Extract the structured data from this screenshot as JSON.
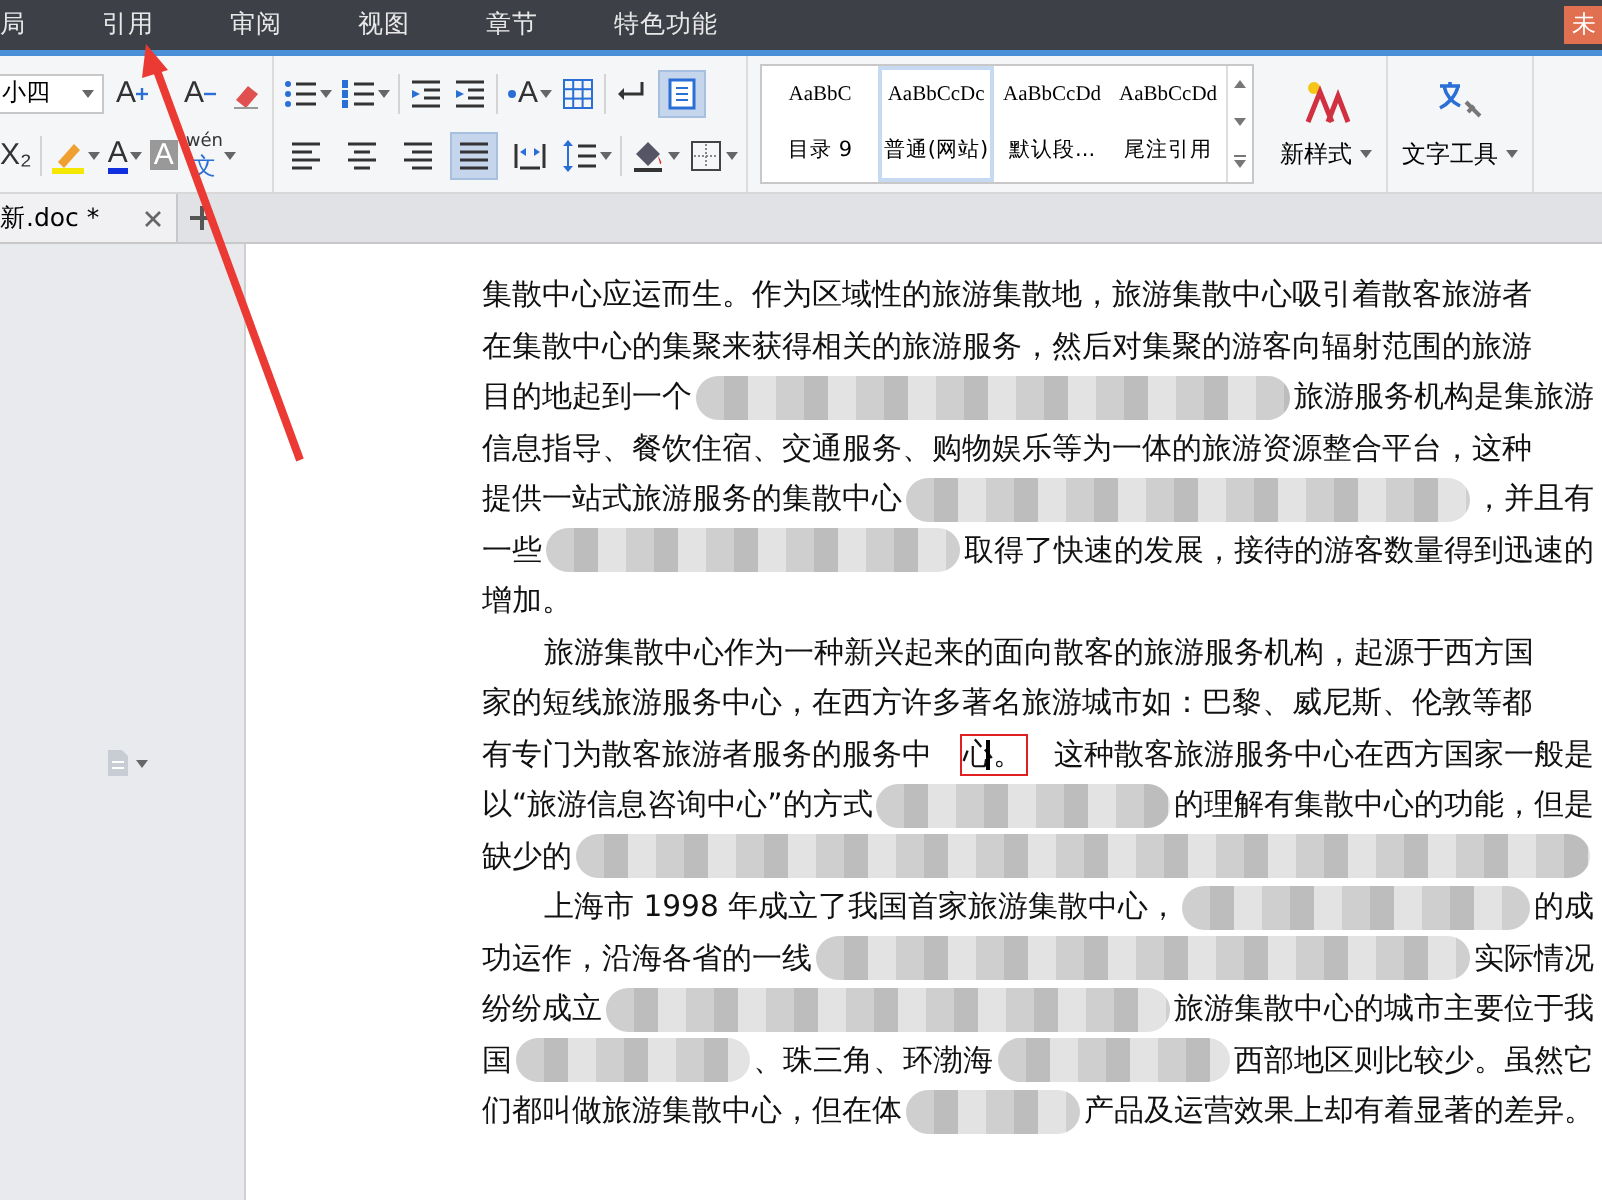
{
  "menu_tabs": [
    {
      "label": "局"
    },
    {
      "label": "引用"
    },
    {
      "label": "审阅"
    },
    {
      "label": "视图"
    },
    {
      "label": "章节"
    },
    {
      "label": "特色功能"
    }
  ],
  "login_button": "未",
  "ribbon": {
    "font_size": "小四",
    "row1": [
      {
        "kind": "grow-font",
        "glyph": "A"
      },
      {
        "kind": "shrink-font",
        "glyph": "A"
      },
      {
        "kind": "clear-format"
      },
      {
        "kind": "bullets"
      },
      {
        "kind": "numbering"
      },
      {
        "kind": "sep"
      },
      {
        "kind": "outdent"
      },
      {
        "kind": "indent"
      },
      {
        "kind": "sep"
      },
      {
        "kind": "text-direction",
        "glyph": "A"
      },
      {
        "kind": "table-grid"
      },
      {
        "kind": "sep"
      },
      {
        "kind": "return-mark"
      },
      {
        "kind": "border-box",
        "on": true
      }
    ],
    "row2": [
      {
        "kind": "subscript",
        "glyph": "X₂"
      },
      {
        "kind": "sep"
      },
      {
        "kind": "highlight"
      },
      {
        "kind": "font-color",
        "glyph": "A"
      },
      {
        "kind": "char-shading",
        "glyph": "A"
      },
      {
        "kind": "pinyin",
        "glyph": "wén",
        "sub": "文"
      }
    ],
    "align": [
      {
        "kind": "left",
        "selected": false
      },
      {
        "kind": "center",
        "selected": false
      },
      {
        "kind": "right",
        "selected": false
      },
      {
        "kind": "justify",
        "selected": true
      },
      {
        "kind": "distributed",
        "selected": false
      }
    ],
    "row2b": [
      {
        "kind": "line-spacing"
      },
      {
        "kind": "sep"
      },
      {
        "kind": "shading"
      },
      {
        "kind": "borders"
      }
    ],
    "styles": [
      {
        "sample": "AaBbC",
        "label": "目录 9",
        "selected": false
      },
      {
        "sample": "AaBbCcDc",
        "label": "普通(网站)",
        "selected": true
      },
      {
        "sample": "AaBbCcDd",
        "label": "默认段...",
        "selected": false
      },
      {
        "sample": "AaBbCcDd",
        "label": "尾注引用",
        "selected": false
      }
    ],
    "new_style": "新样式",
    "text_tools": "文字工具"
  },
  "doc_tab": {
    "title": "新.doc *"
  },
  "document": {
    "lines": [
      {
        "indent": false,
        "segments": [
          {
            "kind": "text",
            "text": "集散中心应运而生。作为区域性的旅游集散地，旅游集散中心吸引着散客旅游者"
          }
        ]
      },
      {
        "indent": false,
        "segments": [
          {
            "kind": "text",
            "text": "在集散中心的集聚来获得相关的旅游服务，然后对集聚的游客向辐射范围的旅游"
          }
        ]
      },
      {
        "indent": false,
        "segments": [
          {
            "kind": "text",
            "text": "目的地起到一个"
          },
          {
            "kind": "redacted"
          },
          {
            "kind": "text",
            "text": "旅游服务机构是集旅游"
          }
        ]
      },
      {
        "indent": false,
        "segments": [
          {
            "kind": "text",
            "text": "信息指导、餐饮住宿、交通服务、购物娱乐等为一体的旅游资源整合平台，这种"
          }
        ]
      },
      {
        "indent": false,
        "segments": [
          {
            "kind": "text",
            "text": "提供一站式旅游服务的集散中心"
          },
          {
            "kind": "redacted"
          },
          {
            "kind": "text",
            "text": "，并且有"
          }
        ]
      },
      {
        "indent": false,
        "segments": [
          {
            "kind": "text",
            "text": "一些"
          },
          {
            "kind": "redacted"
          },
          {
            "kind": "text",
            "text": "取得了快速的发展，接待的游客数量得到迅速的"
          }
        ]
      },
      {
        "indent": false,
        "segments": [
          {
            "kind": "text",
            "text": "增加。"
          }
        ]
      },
      {
        "indent": true,
        "segments": [
          {
            "kind": "text",
            "text": "旅游集散中心作为一种新兴起来的面向散客的旅游服务机构，起源于西方国"
          }
        ]
      },
      {
        "indent": false,
        "segments": [
          {
            "kind": "text",
            "text": "家的短线旅游服务中心，在西方许多著名旅游城市如：巴黎、威尼斯、伦敦等都"
          }
        ]
      },
      {
        "indent": false,
        "segments": [
          {
            "kind": "text",
            "text": "有专门为散客旅游者服务的服务中"
          },
          {
            "kind": "boxed",
            "text": "心。",
            "cursor": true
          },
          {
            "kind": "text",
            "text": "这种散客旅游服务中心在西方国家一般是"
          }
        ]
      },
      {
        "indent": false,
        "segments": [
          {
            "kind": "text",
            "text": "以“旅游信息咨询中心”的方式"
          },
          {
            "kind": "redacted"
          },
          {
            "kind": "text",
            "text": "的理解有集散中心的功能，但是"
          }
        ]
      },
      {
        "indent": false,
        "segments": [
          {
            "kind": "text",
            "text": "缺少的"
          },
          {
            "kind": "redacted"
          }
        ]
      },
      {
        "indent": true,
        "segments": [
          {
            "kind": "text",
            "text": "上海市 1998 年成立了我国首家旅游集散中心，"
          },
          {
            "kind": "redacted"
          },
          {
            "kind": "text",
            "text": "的成"
          }
        ]
      },
      {
        "indent": false,
        "segments": [
          {
            "kind": "text",
            "text": "功运作，沿海各省的一线"
          },
          {
            "kind": "redacted"
          },
          {
            "kind": "text",
            "text": "实际情况"
          }
        ]
      },
      {
        "indent": false,
        "segments": [
          {
            "kind": "text",
            "text": "纷纷成立"
          },
          {
            "kind": "redacted"
          },
          {
            "kind": "text",
            "text": "旅游集散中心的城市主要位于我"
          }
        ]
      },
      {
        "indent": false,
        "segments": [
          {
            "kind": "text",
            "text": "国"
          },
          {
            "kind": "redacted"
          },
          {
            "kind": "text",
            "text": "、珠三角、环渤海"
          },
          {
            "kind": "redacted"
          },
          {
            "kind": "text",
            "text": "西部地区则比较少。虽然它"
          }
        ]
      },
      {
        "indent": false,
        "segments": [
          {
            "kind": "text",
            "text": "们都叫做旅游集散中心，但在体"
          },
          {
            "kind": "redacted"
          },
          {
            "kind": "text",
            "text": "产品及运营效果上却有着显著的差异。"
          }
        ]
      }
    ]
  }
}
